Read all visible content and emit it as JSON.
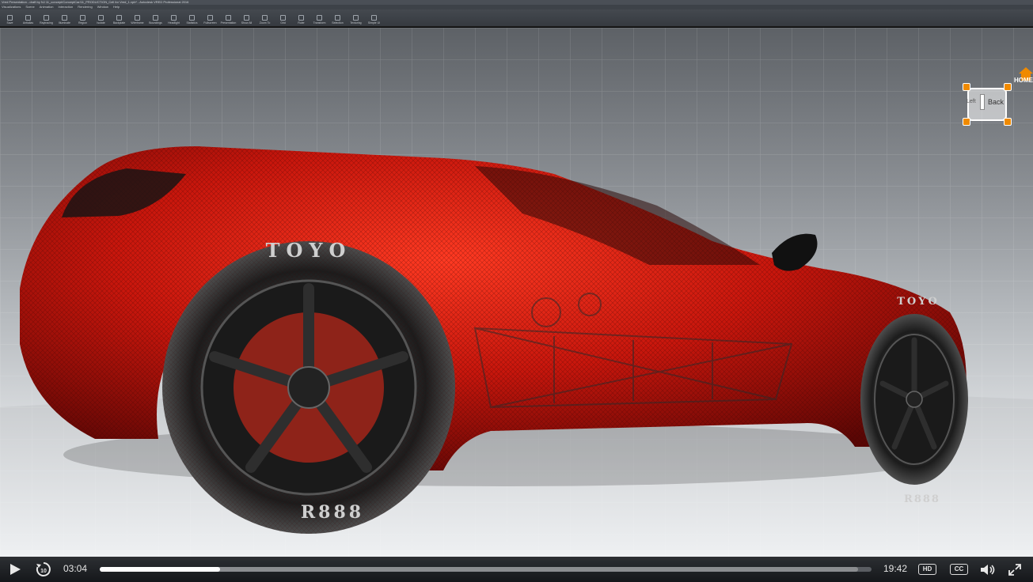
{
  "app": {
    "title": "Vred Presentation - draft by NJ 11_concept/ConceptCar/11_PRODUCTION_Cell for Vred_1.vpb* - Autodesk VRED Professional 2016"
  },
  "menu": [
    "Visualizations",
    "Scene",
    "Animation",
    "Interaction",
    "Rendering",
    "Window",
    "Help"
  ],
  "toolbar": {
    "tools": [
      {
        "label": "Save",
        "icon": "save-icon"
      },
      {
        "label": "Antialias",
        "icon": "antialias-icon"
      },
      {
        "label": "Raytracing",
        "icon": "raytracing-icon"
      },
      {
        "label": "Illuminate",
        "icon": "illuminate-icon"
      },
      {
        "label": "Region",
        "icon": "region-icon"
      },
      {
        "label": "Isolate",
        "icon": "isolate-icon"
      },
      {
        "label": "Backplate",
        "icon": "backplate-icon"
      },
      {
        "label": "Wireframe",
        "icon": "wireframe-icon"
      },
      {
        "label": "Boundings",
        "icon": "boundings-icon"
      },
      {
        "label": "Headlight",
        "icon": "headlight-icon"
      },
      {
        "label": "Statistics",
        "icon": "statistics-icon"
      },
      {
        "label": "Fullscreen",
        "icon": "fullscreen-icon"
      },
      {
        "label": "Presentation",
        "icon": "presentation-icon"
      },
      {
        "label": "Show All",
        "icon": "show-all-icon"
      },
      {
        "label": "Zoom To",
        "icon": "zoom-to-icon"
      },
      {
        "label": "Grid",
        "icon": "grid-icon"
      },
      {
        "label": "Ruler",
        "icon": "ruler-icon"
      },
      {
        "label": "Transform",
        "icon": "transform-icon"
      },
      {
        "label": "Selection",
        "icon": "selection-icon"
      },
      {
        "label": "Texturing",
        "icon": "texturing-icon"
      },
      {
        "label": "Simple UI",
        "icon": "simple-ui-icon"
      }
    ]
  },
  "viewport": {
    "home_label": "HOME",
    "viewcube": {
      "left": "Left",
      "back": "Back"
    },
    "tire_brand": "TOYO",
    "tire_sidewall": "R888",
    "colors": {
      "car_paint": "#c8160c",
      "viewcube_accent": "#f08a00"
    }
  },
  "player": {
    "current_time": "03:04",
    "duration": "19:42",
    "progress_fraction": 0.156,
    "buffered_fraction": 0.983,
    "hd_label": "HD",
    "cc_label": "CC",
    "icons": [
      "play-icon",
      "rewind-10-icon",
      "volume-icon",
      "fullscreen-icon"
    ]
  }
}
